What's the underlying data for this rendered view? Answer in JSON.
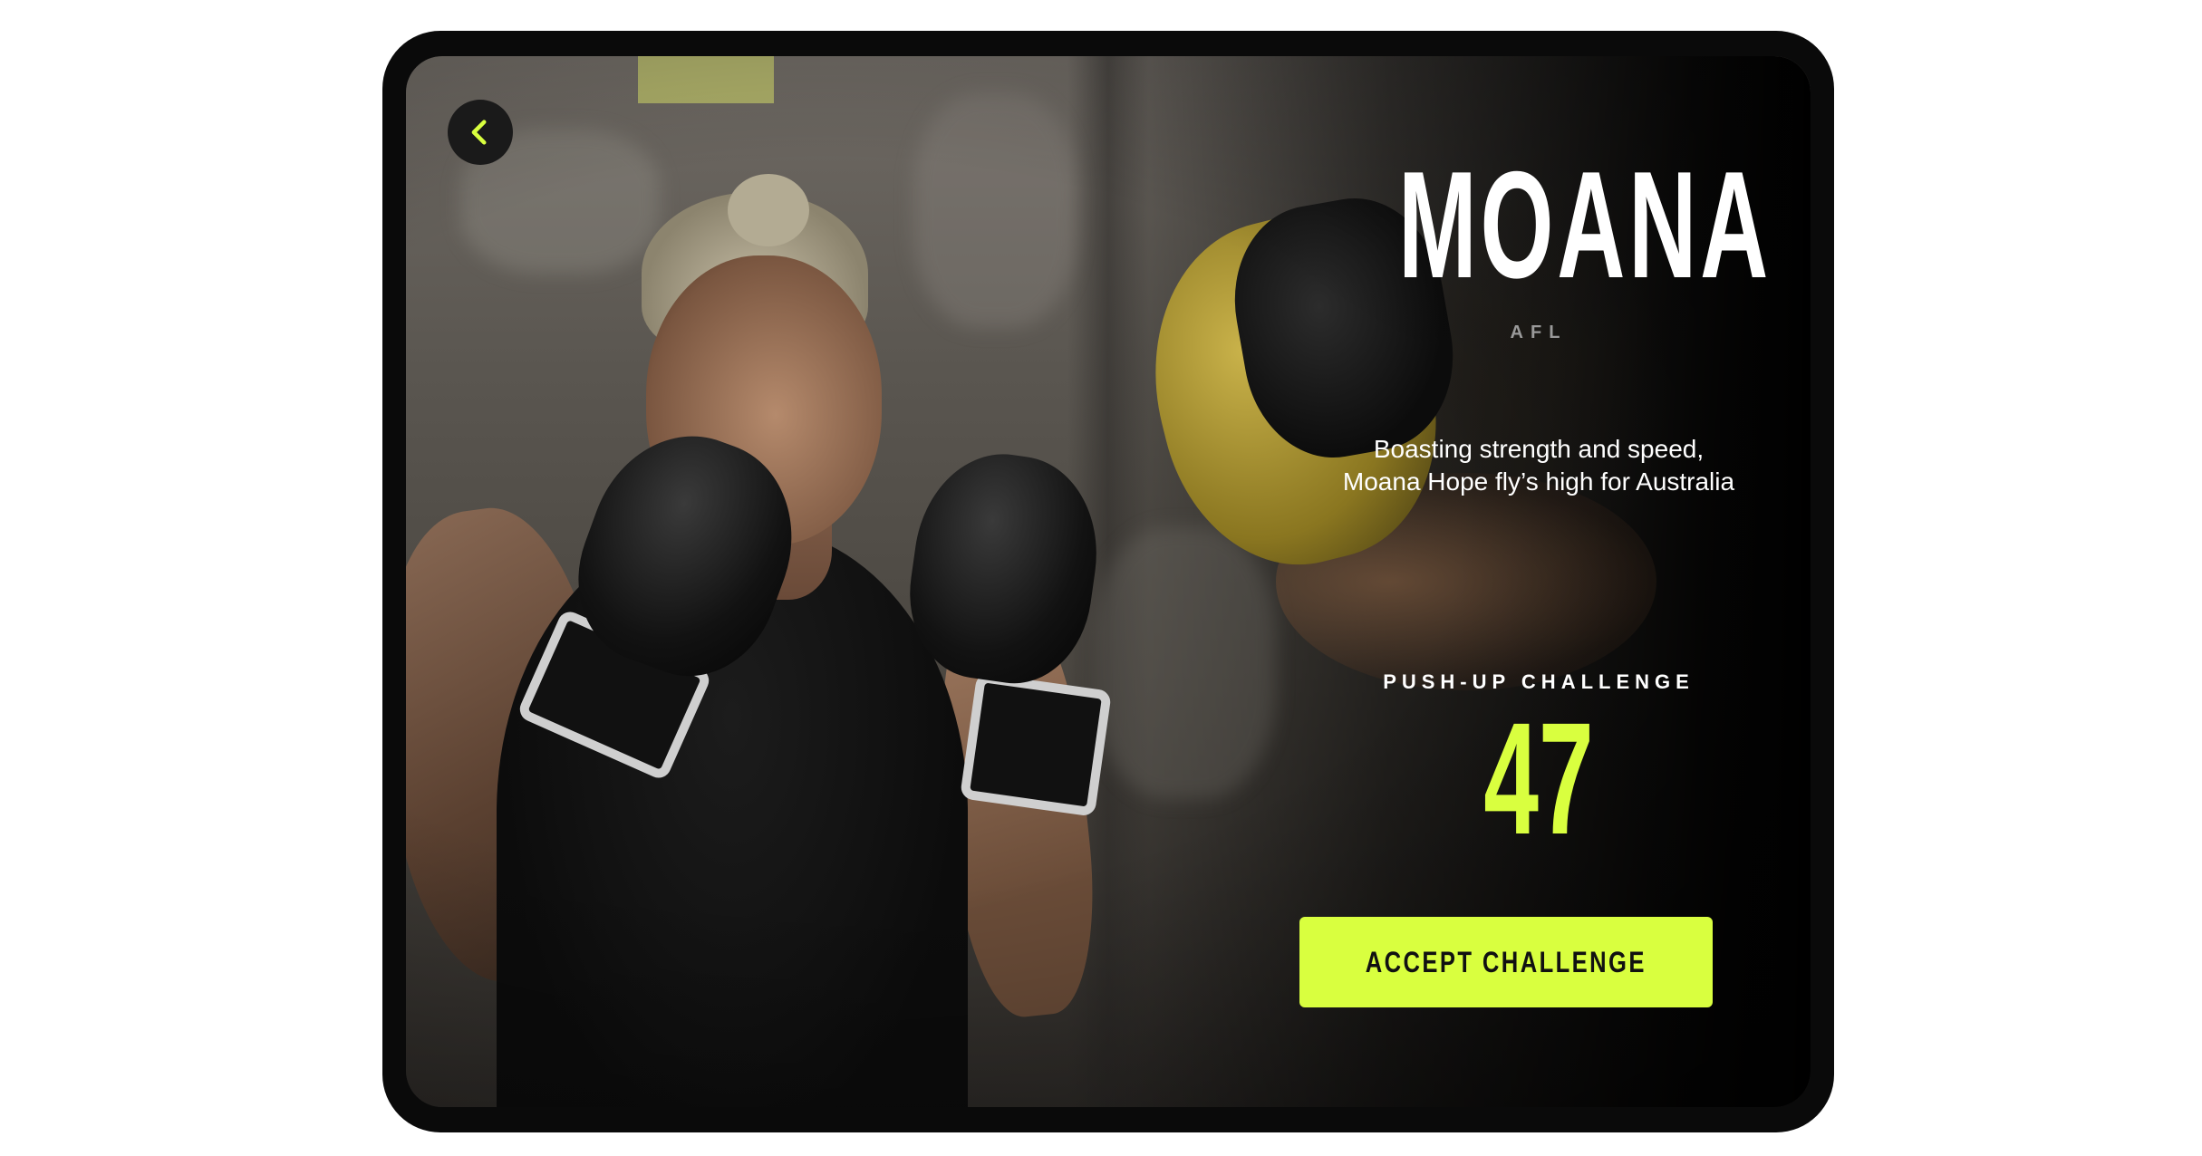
{
  "profile": {
    "name": "MOANA",
    "league": "AFL",
    "description": "Boasting strength and speed, Moana Hope fly’s high for Australia"
  },
  "challenge": {
    "label": "PUSH-UP CHALLENGE",
    "value": "47"
  },
  "actions": {
    "accept_label": "ACCEPT CHALLENGE",
    "back_icon": "chevron-left-icon"
  },
  "colors": {
    "accent": "#d9ff3f",
    "background": "#000000",
    "text": "#ffffff",
    "muted": "#9a9a9a"
  }
}
